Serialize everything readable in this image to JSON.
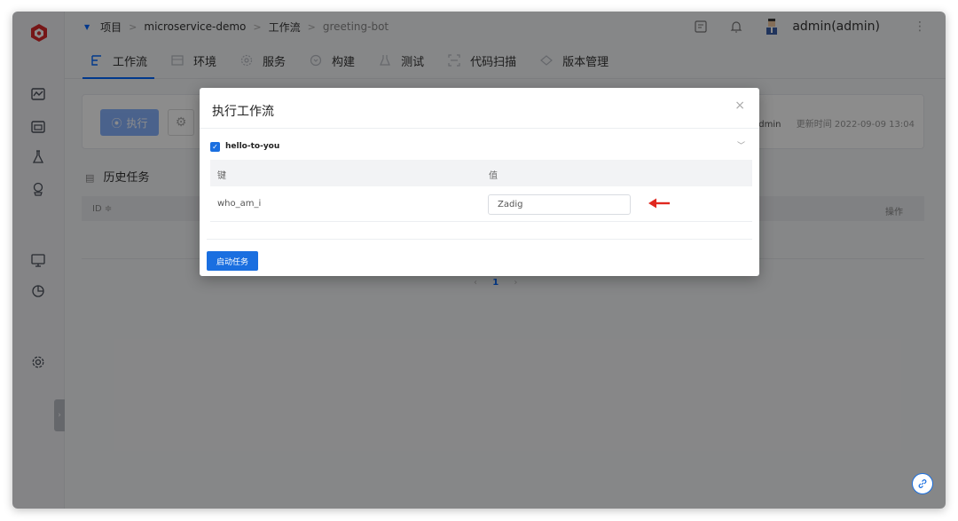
{
  "breadcrumb": {
    "items": [
      "项目",
      "microservice-demo",
      "工作流",
      "greeting-bot"
    ],
    "separator": ">"
  },
  "user": {
    "name": "admin(admin)"
  },
  "tabs": [
    {
      "label": "工作流",
      "icon": "workflow-icon",
      "active": true
    },
    {
      "label": "环境",
      "icon": "environment-icon",
      "active": false
    },
    {
      "label": "服务",
      "icon": "service-icon",
      "active": false
    },
    {
      "label": "构建",
      "icon": "build-icon",
      "active": false
    },
    {
      "label": "测试",
      "icon": "test-icon",
      "active": false
    },
    {
      "label": "代码扫描",
      "icon": "code-scan-icon",
      "active": false
    },
    {
      "label": "版本管理",
      "icon": "version-icon",
      "active": false
    }
  ],
  "panel": {
    "run_label": "执行",
    "updated_by": "admin",
    "updated_label": "更新时间 2022-09-09 13:04"
  },
  "history": {
    "title": "历史任务",
    "col_id": "ID ≑",
    "col_op": "操作",
    "page": "1"
  },
  "modal": {
    "title": "执行工作流",
    "workflow_name": "hello-to-you",
    "key_header": "键",
    "value_header": "值",
    "row_key": "who_am_i",
    "row_value": "Zadig",
    "start_label": "启动任务"
  },
  "colors": {
    "primary": "#1a6fe0",
    "accent_arrow": "#e0281f"
  }
}
